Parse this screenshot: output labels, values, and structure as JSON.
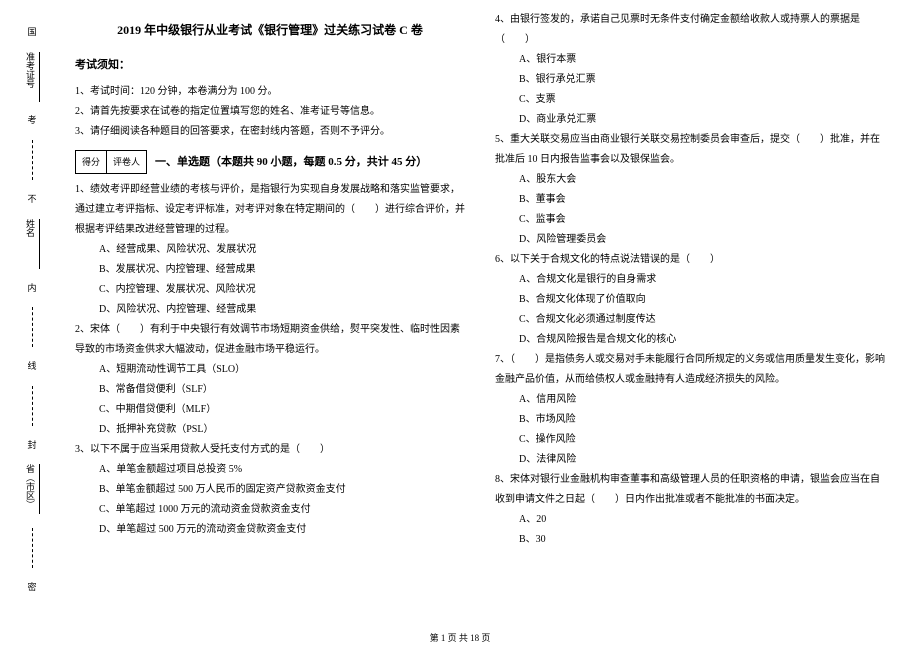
{
  "binding": {
    "items": [
      "国",
      "考",
      "不",
      "内",
      "线",
      "封",
      "密"
    ],
    "fields": [
      "省（市区）",
      "姓名",
      "准考证号"
    ]
  },
  "title": "2019 年中级银行从业考试《银行管理》过关练习试卷 C 卷",
  "notice": {
    "header": "考试须知：",
    "items": [
      "1、考试时间：120 分钟，本卷满分为 100 分。",
      "2、请首先按要求在试卷的指定位置填写您的姓名、准考证号等信息。",
      "3、请仔细阅读各种题目的回答要求，在密封线内答题，否则不予评分。"
    ]
  },
  "scorebox": {
    "score": "得分",
    "marker": "评卷人"
  },
  "section1": {
    "header": "一、单选题（本题共 90 小题，每题 0.5 分，共计 45 分）"
  },
  "q1": {
    "text": "1、绩效考评即经营业绩的考核与评价，是指银行为实现自身发展战略和落实监管要求，通过建立考评指标、设定考评标准，对考评对象在特定期间的（　　）进行综合评价，并根据考评结果改进经营管理的过程。",
    "a": "A、经营成果、风险状况、发展状况",
    "b": "B、发展状况、内控管理、经营成果",
    "c": "C、内控管理、发展状况、风险状况",
    "d": "D、风险状况、内控管理、经营成果"
  },
  "q2": {
    "text": "2、宋体（　　）有利于中央银行有效调节市场短期资金供给，熨平突发性、临时性因素导致的市场资金供求大幅波动，促进金融市场平稳运行。",
    "a": "A、短期流动性调节工具（SLO）",
    "b": "B、常备借贷便利（SLF）",
    "c": "C、中期借贷便利（MLF）",
    "d": "D、抵押补充贷款（PSL）"
  },
  "q3": {
    "text": "3、以下不属于应当采用贷款人受托支付方式的是（　　）",
    "a": "A、单笔金额超过项目总投资 5%",
    "b": "B、单笔金额超过 500 万人民币的固定资产贷款资金支付",
    "c": "C、单笔超过 1000 万元的流动资金贷款资金支付",
    "d": "D、单笔超过 500 万元的流动资金贷款资金支付"
  },
  "q4": {
    "text": "4、由银行签发的，承诺自己见票时无条件支付确定金额给收款人或持票人的票据是（　　）",
    "a": "A、银行本票",
    "b": "B、银行承兑汇票",
    "c": "C、支票",
    "d": "D、商业承兑汇票"
  },
  "q5": {
    "text": "5、重大关联交易应当由商业银行关联交易控制委员会审查后，提交（　　）批准，并在批准后 10 日内报告监事会以及银保监会。",
    "a": "A、股东大会",
    "b": "B、董事会",
    "c": "C、监事会",
    "d": "D、风险管理委员会"
  },
  "q6": {
    "text": "6、以下关于合规文化的特点说法错误的是（　　）",
    "a": "A、合规文化是银行的自身需求",
    "b": "B、合规文化体现了价值取向",
    "c": "C、合规文化必须通过制度传达",
    "d": "D、合规风险报告是合规文化的核心"
  },
  "q7": {
    "text": "7、（　　）是指债务人或交易对手未能履行合同所规定的义务或信用质量发生变化，影响金融产品价值，从而给债权人或金融持有人造成经济损失的风险。",
    "a": "A、信用风险",
    "b": "B、市场风险",
    "c": "C、操作风险",
    "d": "D、法律风险"
  },
  "q8": {
    "text": "8、宋体对银行业金融机构审查董事和高级管理人员的任职资格的申请，银监会应当在自收到申请文件之日起（　　）日内作出批准或者不能批准的书面决定。",
    "a": "A、20",
    "b": "B、30"
  },
  "footer": "第 1 页 共 18 页"
}
